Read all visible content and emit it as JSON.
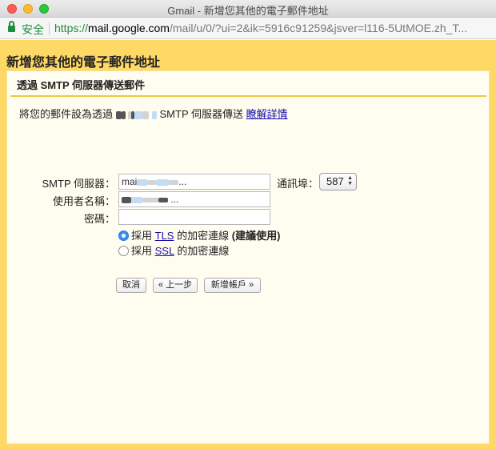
{
  "window": {
    "title": "Gmail - 新增您其他的電子郵件地址"
  },
  "addressbar": {
    "secure_label": "安全",
    "url_scheme": "https://",
    "url_host": "mail.google.com",
    "url_path": "/mail/u/0/?ui=2&ik=5916c91259&jsver=l116-5UtMOE.zh_T..."
  },
  "dialog": {
    "header": "新增您其他的電子郵件地址",
    "section_title": "透過 SMTP 伺服器傳送郵件",
    "intro_prefix": "將您的郵件設為透過",
    "intro_mid": "SMTP 伺服器傳送",
    "intro_link": "瞭解詳情"
  },
  "form": {
    "smtp_label": "SMTP 伺服器：",
    "smtp_value": "mai",
    "smtp_value_tail": "...",
    "port_label": "通訊埠：",
    "port_value": "587",
    "username_label": "使用者名稱：",
    "username_value": "...",
    "password_label": "密碼：",
    "password_value": ""
  },
  "security": {
    "tls_prefix": "採用",
    "tls_link": "TLS",
    "tls_suffix": "的加密連線",
    "tls_recommend": "(建議使用)",
    "tls_selected": true,
    "ssl_prefix": "採用",
    "ssl_link": "SSL",
    "ssl_suffix": "的加密連線",
    "ssl_selected": false
  },
  "buttons": {
    "cancel": "取消",
    "back": "« 上一步",
    "add_account": "新增帳戶 »"
  }
}
